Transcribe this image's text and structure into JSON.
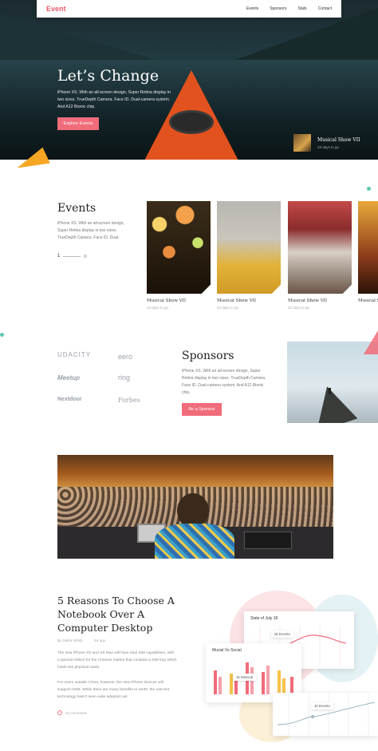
{
  "nav": {
    "logo": "Event",
    "links": [
      "Events",
      "Sponsors",
      "Stats",
      "Contact"
    ]
  },
  "hero": {
    "title": "Let’s Change",
    "text": "iPhone XS. With an all-screen design, Super Retina display in two sizes. TrueDepth Camera. Face ID. Dual-camera system. And A12 Bionic chip.",
    "button": "Explore Events",
    "card_title": "Musical Show VII",
    "card_sub": "23 days to go"
  },
  "events": {
    "title": "Events",
    "text": "iPhone XS. With an all-screen design, Super Retina display in two sizes. TrueDepth Camera. Face ID. Dual-",
    "page": "1",
    "cards": [
      {
        "title": "Musical Show VII",
        "sub": "23 days to go"
      },
      {
        "title": "Musical Show VII",
        "sub": "23 days to go"
      },
      {
        "title": "Musical Show VII",
        "sub": "23 days to go"
      },
      {
        "title": "Musical S",
        "sub": ""
      }
    ]
  },
  "sponsors": {
    "logos": [
      "UDACITY",
      "eero",
      "Meetup",
      "ring",
      "Nextdoor",
      "Forbes"
    ],
    "title": "Sponsors",
    "text": "iPhone XS. With an all-screen design, Super Retina display in two sizes. TrueDepth Camera. Face ID. Dual-camera system. And A12 Bionic chip.",
    "button": "Be a Sponsor"
  },
  "article": {
    "title": "5 Reasons To Choose A Notebook Over A Computer Desktop",
    "author": "By Dallas White",
    "date": "2w ago",
    "p1": "The new iPhone XS and XS Max will have dual SIM capabilities, with a special edition for the Chinese market that contains a SIM tray which holds two physical cards.",
    "p2": "For users outside China, however, the new iPhone devices will support eSIM. While there are many benefits to eSIM, the nascent technology hasn't seen wide adoption yet.",
    "comments": "22 comments"
  },
  "stats": {
    "panel1_title": "Stats of July 18",
    "chip1": "2k Events",
    "panel2_title": "Mucial Vs Social",
    "chip2": "1k Musical",
    "chip3": "1k Events",
    "colors": {
      "pink": "#f06c7a",
      "yellow": "#f5c24a"
    }
  }
}
